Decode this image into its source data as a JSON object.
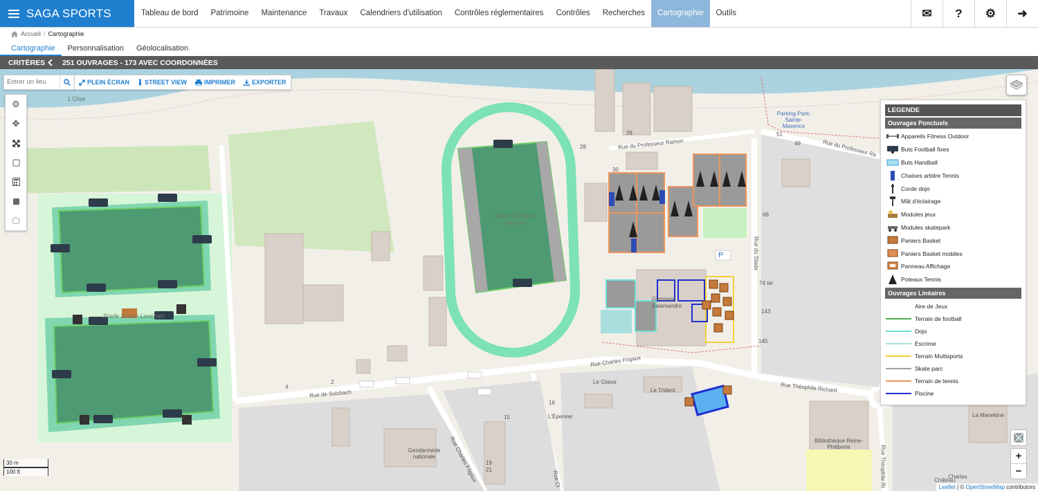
{
  "app": {
    "title": "SAGA SPORTS"
  },
  "nav": {
    "items": [
      {
        "label": "Tableau de bord"
      },
      {
        "label": "Patrimoine"
      },
      {
        "label": "Maintenance"
      },
      {
        "label": "Travaux"
      },
      {
        "label": "Calendriers d'utilisation"
      },
      {
        "label": "Contrôles réglementaires"
      },
      {
        "label": "Contrôles"
      },
      {
        "label": "Recherches"
      },
      {
        "label": "Cartographie",
        "active": true
      },
      {
        "label": "Outils"
      }
    ]
  },
  "tools": [
    "mail-icon",
    "help-icon",
    "settings-icon",
    "logout-icon"
  ],
  "tool_glyphs": {
    "mail": "✉",
    "help": "?",
    "settings": "⚙",
    "logout": "➜"
  },
  "breadcrumb": {
    "home": "Accueil",
    "separator": "/",
    "current": "Cartographie"
  },
  "subtabs": [
    {
      "label": "Cartographie",
      "active": true
    },
    {
      "label": "Personnalisation"
    },
    {
      "label": "Géolocalisation"
    }
  ],
  "criteria": {
    "label": "CRITÈRES",
    "count": "251 OUVRAGES - 173 AVEC COORDONNÉES"
  },
  "map": {
    "search_placeholder": "Entrer un lieu",
    "actions": {
      "fullscreen": "PLEIN ÉCRAN",
      "streetview": "STREET VIEW",
      "print": "IMPRIMER",
      "export": "EXPORTER"
    },
    "scale": {
      "metric": "30 m",
      "imperial": "100 ft"
    },
    "labels": {
      "river": "L'Oise",
      "stadium": "Stade Georges Decroze",
      "stadium2": "Stade Simon Louchart",
      "gymnase": "Gymnase Salamandre",
      "rue_ramon": "Rue du Professeur Ramon",
      "rue_ramon2": "Rue du Professeur Ra",
      "rue_frigaux": "Rue Charles Frigaux",
      "rue_frigaux2": "Rue Charles Frigaux",
      "rue_sulzbach": "Rue de Sulzbach",
      "rue_stade": "Rue du Stade",
      "rue_richard": "Rue Théophile Richard",
      "rue_richard2": "Rue Théophile Ri",
      "rue_cl": "Rue Cl",
      "parking": "Parking Pont-Sainte-Maxence",
      "le_glaive": "Le Glaive",
      "le_trident": "Le Trident",
      "l_epervier": "L'Épervier",
      "gendarmerie": "Gendarmerie nationale",
      "bibliotheque": "Bibliothèque Reine-Philiberte",
      "la_manekine": "La Manekine",
      "chateau": "Château",
      "charles": "Charles",
      "n26": "26",
      "n28": "28",
      "n30": "30",
      "n51": "51",
      "n49": "49",
      "n66": "66",
      "n74": "74 ter",
      "n143": "143",
      "n145": "145",
      "n4": "4",
      "n2": "2",
      "n16": "16",
      "n15": "15",
      "n19": "19",
      "n21": "21",
      "p": "P"
    },
    "attribution": {
      "leaflet": "Leaflet",
      "sep": "| ©",
      "osm": "OpenStreetMap",
      "rest": "contributors"
    },
    "zoom": {
      "in": "+",
      "out": "−"
    }
  },
  "legend": {
    "title": "LEGENDE",
    "ponctuels_title": "Ouvrages Ponctuels",
    "ponctuels": [
      {
        "label": "Appareils Fitness Outdoor",
        "icon": "fitness-icon"
      },
      {
        "label": "Buts Football fixes",
        "icon": "football-goal-icon"
      },
      {
        "label": "Buts Handball",
        "icon": "handball-goal-icon"
      },
      {
        "label": "Chaises arbitre Tennis",
        "icon": "umpire-chair-icon"
      },
      {
        "label": "Corde dojo",
        "icon": "dojo-rope-icon"
      },
      {
        "label": "Mât d'éclairage",
        "icon": "light-mast-icon"
      },
      {
        "label": "Modules jeux",
        "icon": "play-module-icon"
      },
      {
        "label": "Modules skatepark",
        "icon": "skatepark-module-icon"
      },
      {
        "label": "Paniers Basket",
        "icon": "basket-hoop-icon"
      },
      {
        "label": "Paniers Basket mobiles",
        "icon": "mobile-basket-icon"
      },
      {
        "label": "Panneau Affichage",
        "icon": "scoreboard-icon"
      },
      {
        "label": "Poteaux Tennis",
        "icon": "tennis-post-icon"
      }
    ],
    "lineaires_title": "Ouvrages Linéaires",
    "lineaires": [
      {
        "label": "Aire de Jeux",
        "color": "#ffffff"
      },
      {
        "label": "Terrain de football",
        "color": "#4caf50"
      },
      {
        "label": "Dojo",
        "color": "#6ee0d8"
      },
      {
        "label": "Escrime",
        "color": "#a8dedb"
      },
      {
        "label": "Terrain Multisports",
        "color": "#f2d13a"
      },
      {
        "label": "Skate parc",
        "color": "#a0a0a0"
      },
      {
        "label": "Terrain de tennis",
        "color": "#f0945a"
      },
      {
        "label": "Piscine",
        "color": "#1e2fd0"
      }
    ]
  },
  "colors": {
    "brand": "#1f7fcf",
    "active_nav": "#8fb7db",
    "water": "#aad3df",
    "grass": "#cde6b9",
    "pitch": "#4e9a72"
  }
}
